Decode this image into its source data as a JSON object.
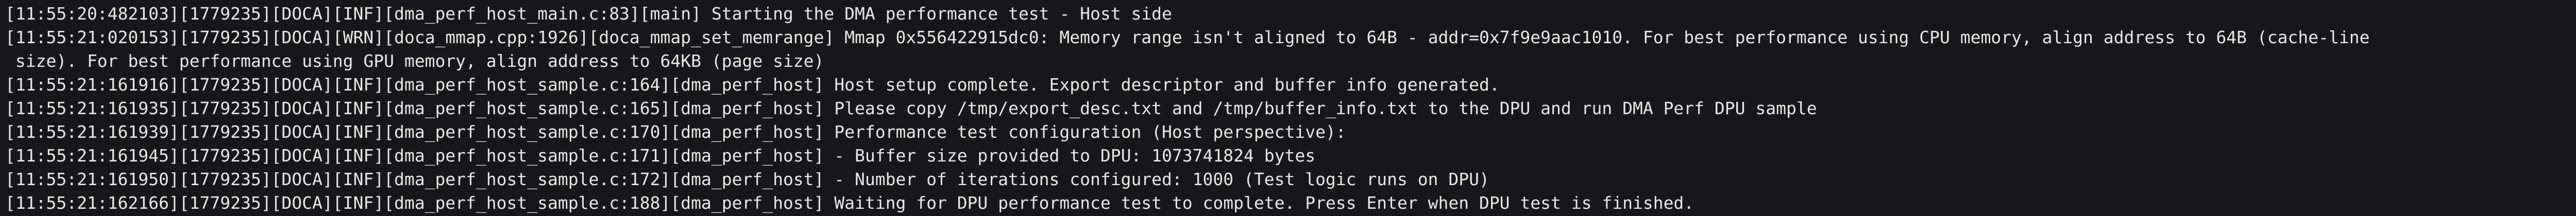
{
  "terminal": {
    "lines": [
      "[11:55:20:482103][1779235][DOCA][INF][dma_perf_host_main.c:83][main] Starting the DMA performance test - Host side",
      "[11:55:21:020153][1779235][DOCA][WRN][doca_mmap.cpp:1926][doca_mmap_set_memrange] Mmap 0x556422915dc0: Memory range isn't aligned to 64B - addr=0x7f9e9aac1010. For best performance using CPU memory, align address to 64B (cache-line",
      " size). For best performance using GPU memory, align address to 64KB (page size)",
      "[11:55:21:161916][1779235][DOCA][INF][dma_perf_host_sample.c:164][dma_perf_host] Host setup complete. Export descriptor and buffer info generated.",
      "[11:55:21:161935][1779235][DOCA][INF][dma_perf_host_sample.c:165][dma_perf_host] Please copy /tmp/export_desc.txt and /tmp/buffer_info.txt to the DPU and run DMA Perf DPU sample",
      "[11:55:21:161939][1779235][DOCA][INF][dma_perf_host_sample.c:170][dma_perf_host] Performance test configuration (Host perspective):",
      "[11:55:21:161945][1779235][DOCA][INF][dma_perf_host_sample.c:171][dma_perf_host] - Buffer size provided to DPU: 1073741824 bytes",
      "[11:55:21:161950][1779235][DOCA][INF][dma_perf_host_sample.c:172][dma_perf_host] - Number of iterations configured: 1000 (Test logic runs on DPU)",
      "[11:55:21:162166][1779235][DOCA][INF][dma_perf_host_sample.c:188][dma_perf_host] Waiting for DPU performance test to complete. Press Enter when DPU test is finished."
    ]
  }
}
